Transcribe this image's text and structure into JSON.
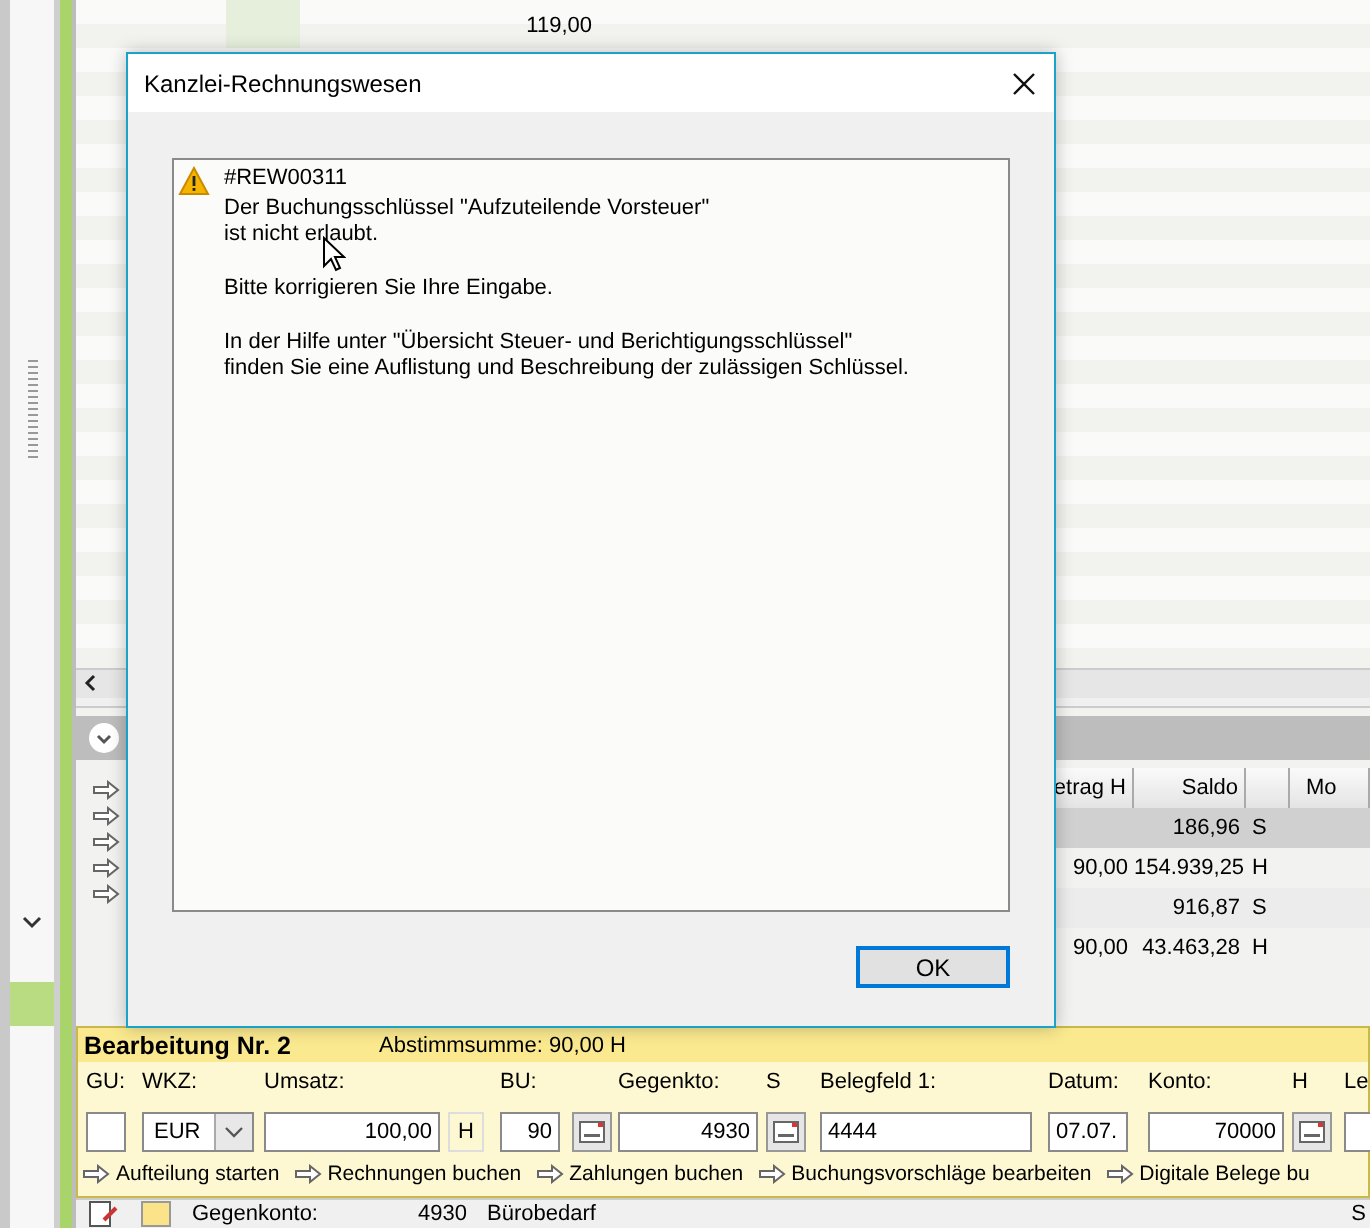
{
  "top_table": {
    "rows": [
      {
        "amount": "119,00"
      }
    ]
  },
  "lower_table": {
    "columns": [
      {
        "label": "etrag H"
      },
      {
        "label": "Saldo"
      },
      {
        "label": "Mo"
      }
    ],
    "rows": [
      {
        "saldo": "186,96",
        "side": "S",
        "selected": true
      },
      {
        "column_1": "90,00",
        "saldo": "154.939,25",
        "side": "H",
        "selected": false
      },
      {
        "saldo": "916,87",
        "side": "S",
        "selected": false
      },
      {
        "column_1": "90,00",
        "saldo": "43.463,28",
        "side": "H",
        "selected": false
      }
    ]
  },
  "booking_panel": {
    "title": "Bearbeitung Nr. 2",
    "summary": "Abstimmsumme: 90,00 H",
    "fields": [
      {
        "kind": "text",
        "label": "GU:"
      },
      {
        "kind": "select",
        "label": "WKZ:",
        "value": "EUR"
      },
      {
        "kind": "text",
        "label": "Umsatz:",
        "value": "100,00"
      },
      {
        "kind": "side",
        "value": "H"
      },
      {
        "kind": "text",
        "label": "BU:",
        "value": "90"
      },
      {
        "kind": "lookup"
      },
      {
        "kind": "text",
        "label": "Gegenkto:",
        "value": "4930"
      },
      {
        "kind": "lookup",
        "label": "S"
      },
      {
        "kind": "text",
        "label": "Belegfeld 1:",
        "value": "4444"
      },
      {
        "kind": "text",
        "label": "Datum:",
        "value": "07.07."
      },
      {
        "kind": "text",
        "label": "Konto:",
        "value": "70000"
      },
      {
        "kind": "lookup",
        "label": "H"
      },
      {
        "kind": "text",
        "label": "Le"
      }
    ],
    "links": [
      "Aufteilung starten",
      "Rechnungen buchen",
      "Zahlungen buchen",
      "Buchungsvorschläge bearbeiten",
      "Digitale Belege bu"
    ]
  },
  "status_row": {
    "label": "Gegenkonto:",
    "account": "4930",
    "name": "Bürobedarf",
    "side": "S"
  },
  "dialog": {
    "title": "Kanzlei-Rechnungswesen",
    "code": "#REW00311",
    "paragraphs": [
      "Der Buchungsschlüssel \"Aufzuteilende Vorsteuer\"\nist nicht erlaubt.",
      "Bitte korrigieren Sie Ihre Eingabe.",
      "In der Hilfe unter \"Übersicht Steuer- und Berichtigungsschlüssel\"\nfinden Sie eine Auflistung und Beschreibung der zulässigen Schlüssel."
    ],
    "buttons": [
      "OK"
    ]
  }
}
